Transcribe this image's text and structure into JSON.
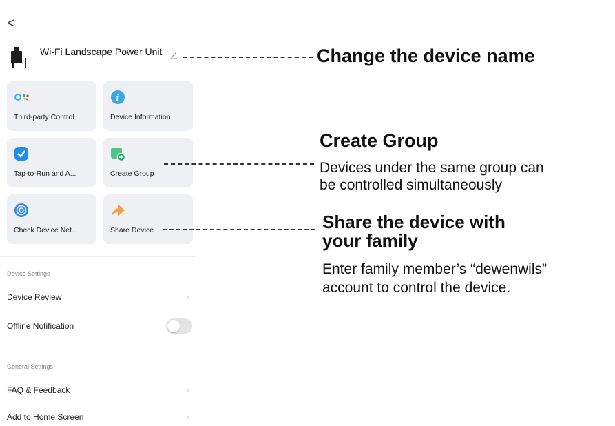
{
  "nav": {
    "back_icon": "chevron-left-icon",
    "back_glyph": "<"
  },
  "device": {
    "name": "Wi-Fi Landscape Power Unit",
    "icon": "power-unit-icon",
    "edit_icon": "pencil-icon"
  },
  "tiles": [
    {
      "label": "Third-party Control",
      "icon": "assistant-icon"
    },
    {
      "label": "Device Information",
      "icon": "info-icon"
    },
    {
      "label": "Tap-to-Run and A...",
      "icon": "shield-check-icon"
    },
    {
      "label": "Create Group",
      "icon": "add-group-icon"
    },
    {
      "label": "Check Device Net...",
      "icon": "network-icon"
    },
    {
      "label": "Share Device",
      "icon": "share-arrow-icon"
    }
  ],
  "device_settings": {
    "title": "Device Settings",
    "items": [
      {
        "label": "Device Review"
      },
      {
        "label": "Offline Notification",
        "toggle_on": false
      }
    ]
  },
  "general_settings": {
    "title": "General Settings",
    "items": [
      {
        "label": "FAQ & Feedback"
      },
      {
        "label": "Add to Home Screen"
      }
    ]
  },
  "annotations": {
    "rename": {
      "title": "Change the device name"
    },
    "group": {
      "title": "Create Group",
      "line1": "Devices under the same group can",
      "line2": "be controlled simultaneously"
    },
    "share": {
      "title_line1": "Share the device with",
      "title_line2": "your family",
      "line1": "Enter family member’s “dewenwils”",
      "line2": "account to control the device."
    }
  },
  "colors": {
    "tile_bg": "#eef0f4",
    "info_icon": "#3aa7e0",
    "check_icon": "#1f8ee6",
    "group_icon": "#4cc68a",
    "share_icon": "#f5a04a",
    "network_icon": "#2f86e8"
  }
}
